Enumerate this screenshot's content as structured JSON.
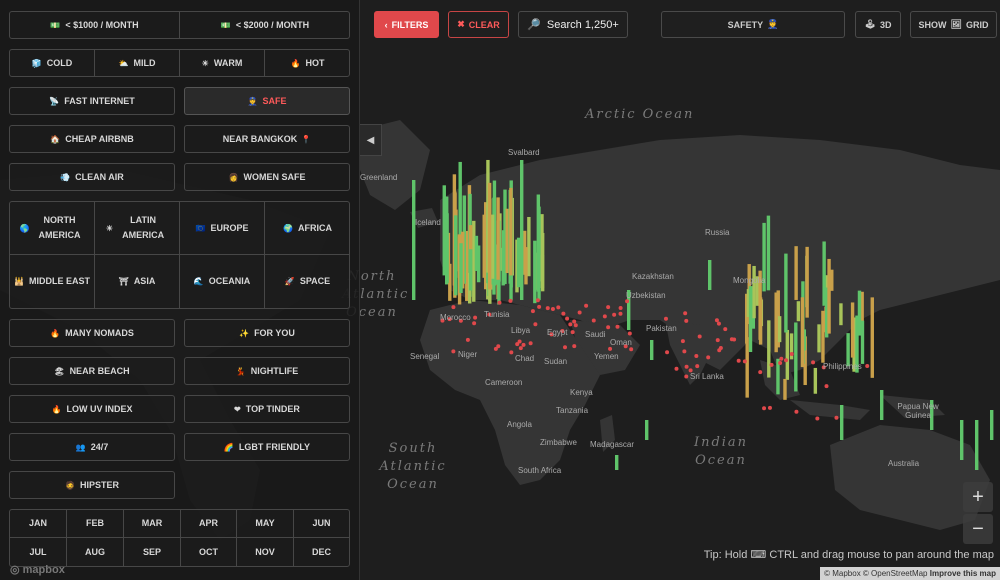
{
  "top": {
    "filters_label": "FILTERS",
    "clear_label": "CLEAR",
    "search_label": "Search 1,250+",
    "safety_label": "SAFETY",
    "view3d_label": "3D",
    "grid_label_show": "SHOW",
    "grid_label": "GRID"
  },
  "budget": [
    "< $1000 / MONTH",
    "< $2000 / MONTH"
  ],
  "temps": [
    "COLD",
    "MILD",
    "WARM",
    "HOT"
  ],
  "pairs": [
    [
      "FAST INTERNET",
      "SAFE"
    ],
    [
      "CHEAP AIRBNB",
      "NEAR BANGKOK"
    ],
    [
      "CLEAN AIR",
      "WOMEN SAFE"
    ]
  ],
  "regions_row1": [
    "NORTH AMERICA",
    "LATIN AMERICA",
    "EUROPE",
    "AFRICA"
  ],
  "regions_row2": [
    "MIDDLE EAST",
    "ASIA",
    "OCEANIA",
    "SPACE"
  ],
  "pairs2": [
    [
      "MANY NOMADS",
      "FOR YOU"
    ],
    [
      "NEAR BEACH",
      "NIGHTLIFE"
    ],
    [
      "LOW UV INDEX",
      "TOP TINDER"
    ],
    [
      "24/7",
      "LGBT FRIENDLY"
    ]
  ],
  "hipster": "HIPSTER",
  "months_row1": [
    "JAN",
    "FEB",
    "MAR",
    "APR",
    "MAY",
    "JUN"
  ],
  "months_row2": [
    "JUL",
    "AUG",
    "SEP",
    "OCT",
    "NOV",
    "DEC"
  ],
  "map": {
    "oceans": {
      "arctic": "Arctic Ocean",
      "north_atlantic": "North Atlantic Ocean",
      "south_atlantic": "South Atlantic Ocean",
      "indian": "Indian Ocean"
    },
    "places": [
      "Svalbard",
      "Greenland",
      "Iceland",
      "Russia",
      "Kazakhstan",
      "Mongolia",
      "Uzbekistan",
      "Pakistan",
      "Tunisia",
      "Morocco",
      "Libya",
      "Egypt",
      "Saudi",
      "Oman",
      "Yemen",
      "Senegal",
      "Niger",
      "Chad",
      "Sudan",
      "Cameroon",
      "Kenya",
      "Tanzania",
      "Angola",
      "Zimbabwe",
      "Madagascar",
      "South Africa",
      "Sri Lanka",
      "Philippines",
      "Papua New Guinea",
      "Australia"
    ],
    "tip": "Tip: Hold",
    "tip_rest": "CTRL and drag mouse to pan around the map",
    "attribution": "© Mapbox © OpenStreetMap",
    "improve": "Improve this map",
    "mapbox": "mapbox"
  }
}
